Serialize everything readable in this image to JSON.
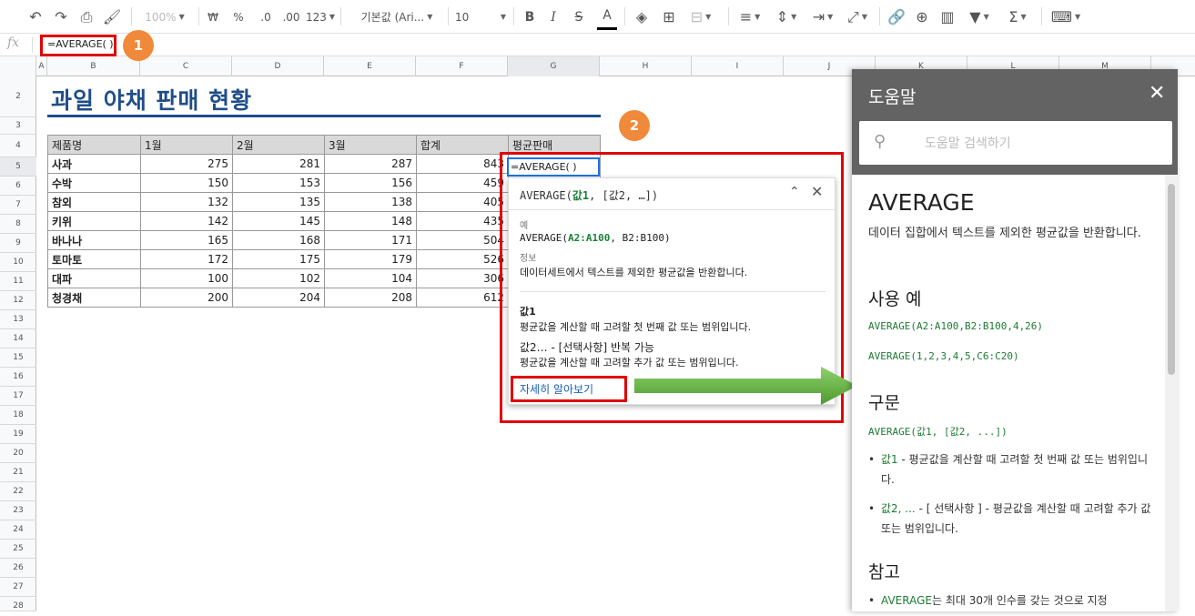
{
  "toolbar": {
    "zoom": "100%",
    "currency": "₩",
    "percent": "%",
    "dec_decrease": ".0",
    "dec_increase": ".00",
    "number_format": "123",
    "font": "기본값 (Ari...",
    "font_size": "10",
    "bold": "B",
    "italic": "I",
    "strike": "S",
    "text_color": "A",
    "sum": "Σ"
  },
  "formula_bar": {
    "fx": "fx",
    "value": "=AVERAGE( )"
  },
  "columns": [
    "A",
    "B",
    "C",
    "D",
    "E",
    "F",
    "G",
    "H",
    "I",
    "J",
    "K",
    "L",
    "M"
  ],
  "rows": [
    "2",
    "3",
    "4",
    "5",
    "6",
    "7",
    "8",
    "9",
    "10",
    "11",
    "12",
    "13",
    "14",
    "15",
    "16",
    "17",
    "18",
    "19",
    "20",
    "21",
    "22",
    "23",
    "24",
    "25",
    "26",
    "27",
    "28"
  ],
  "sheet": {
    "title": "과일 야채 판매 현황",
    "headers": [
      "제품명",
      "1월",
      "2월",
      "3월",
      "합계",
      "평균판매"
    ],
    "data": [
      [
        "사과",
        "275",
        "281",
        "287",
        "843",
        ""
      ],
      [
        "수박",
        "150",
        "153",
        "156",
        "459",
        ""
      ],
      [
        "참외",
        "132",
        "135",
        "138",
        "405",
        ""
      ],
      [
        "키위",
        "142",
        "145",
        "148",
        "435",
        ""
      ],
      [
        "바나나",
        "165",
        "168",
        "171",
        "504",
        ""
      ],
      [
        "토마토",
        "172",
        "175",
        "179",
        "526",
        ""
      ],
      [
        "대파",
        "100",
        "102",
        "104",
        "306",
        ""
      ],
      [
        "청경채",
        "200",
        "204",
        "208",
        "612",
        ""
      ]
    ],
    "active_cell": "=AVERAGE( )"
  },
  "badges": {
    "one": "1",
    "two": "2"
  },
  "popup": {
    "sig_fn": "AVERAGE(",
    "sig_arg1": "값1",
    "sig_rest": ", [값2, …])",
    "example_label": "예",
    "example_fn": "AVERAGE(",
    "example_arg": "A2:A100",
    "example_rest": ", B2:B100)",
    "info_label": "정보",
    "info_text": "데이터세트에서 텍스트를 제외한 평균값을 반환합니다.",
    "arg1_label": "값1",
    "arg1_desc": "평균값을 계산할 때 고려할 첫 번째 값 또는 범위입니다.",
    "arg2_label": "값2… - [선택사항] 반복 가능",
    "arg2_desc": "평균값을 계산할 때 고려할 추가 값 또는 범위입니다.",
    "learn_more": "자세히 알아보기"
  },
  "help": {
    "title": "도움말",
    "search_placeholder": "도움말 검색하기",
    "fn_name": "AVERAGE",
    "fn_desc": "데이터 집합에서 텍스트를 제외한 평균값을 반환합니다.",
    "usage_heading": "사용 예",
    "usage1": "AVERAGE(A2:A100,B2:B100,4,26)",
    "usage2": "AVERAGE(1,2,3,4,5,C6:C20)",
    "syntax_heading": "구문",
    "syntax": "AVERAGE(값1, [값2, ...])",
    "bullet1_code": "값1",
    "bullet1_text": " - 평균값을 계산할 때 고려할 첫 번째 값 또는 범위입니다.",
    "bullet2_code": "값2, ...",
    "bullet2_text": " - [ 선택사항 ] - 평균값을 계산할 때 고려할 추가 값 또는 범위입니다.",
    "notes_heading": "참고",
    "bullet3_code": "AVERAGE",
    "bullet3_text": "는 최대 30개 인수를 갖는 것으로 지정"
  }
}
